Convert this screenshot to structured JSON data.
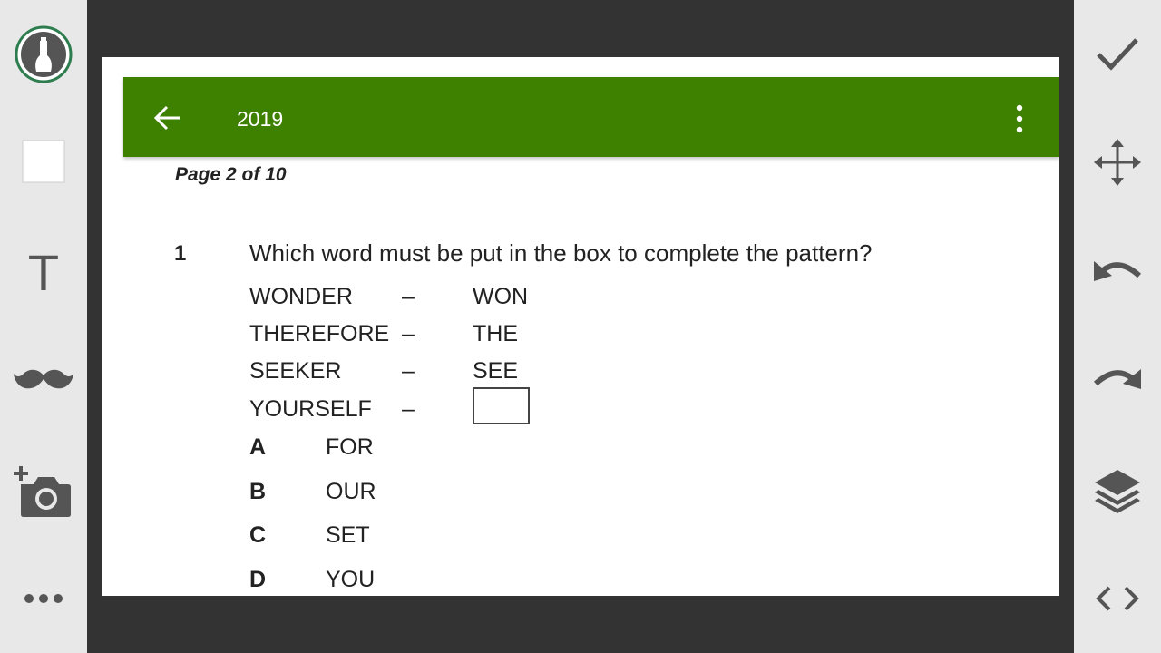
{
  "editor": {
    "left_tools": [
      {
        "icon": "pen-icon"
      },
      {
        "icon": "rectangle-icon"
      },
      {
        "icon": "text-icon",
        "glyph": "T"
      },
      {
        "icon": "mustache-icon"
      },
      {
        "icon": "add-photo-icon"
      },
      {
        "icon": "more-icon"
      }
    ],
    "right_tools": [
      {
        "icon": "check-icon"
      },
      {
        "icon": "move-icon"
      },
      {
        "icon": "undo-icon"
      },
      {
        "icon": "redo-icon"
      },
      {
        "icon": "layers-icon"
      },
      {
        "icon": "code-icon"
      }
    ],
    "accent_color": "#2e7d4f"
  },
  "app": {
    "title": "2019",
    "bar_color": "#3e8000"
  },
  "document": {
    "page_label": "Page 2 of 10",
    "question_number": "1",
    "question_text": "Which word must be put in the box to complete the pattern?",
    "pattern": [
      {
        "word": "WONDER",
        "dash": "–",
        "short": "WON"
      },
      {
        "word": "THEREFORE",
        "dash": "–",
        "short": "THE"
      },
      {
        "word": "SEEKER",
        "dash": "–",
        "short": "SEE"
      },
      {
        "word": "YOURSELF",
        "dash": "–",
        "short": ""
      }
    ],
    "options": [
      {
        "letter": "A",
        "value": "FOR"
      },
      {
        "letter": "B",
        "value": "OUR"
      },
      {
        "letter": "C",
        "value": "SET"
      },
      {
        "letter": "D",
        "value": "YOU"
      }
    ]
  }
}
